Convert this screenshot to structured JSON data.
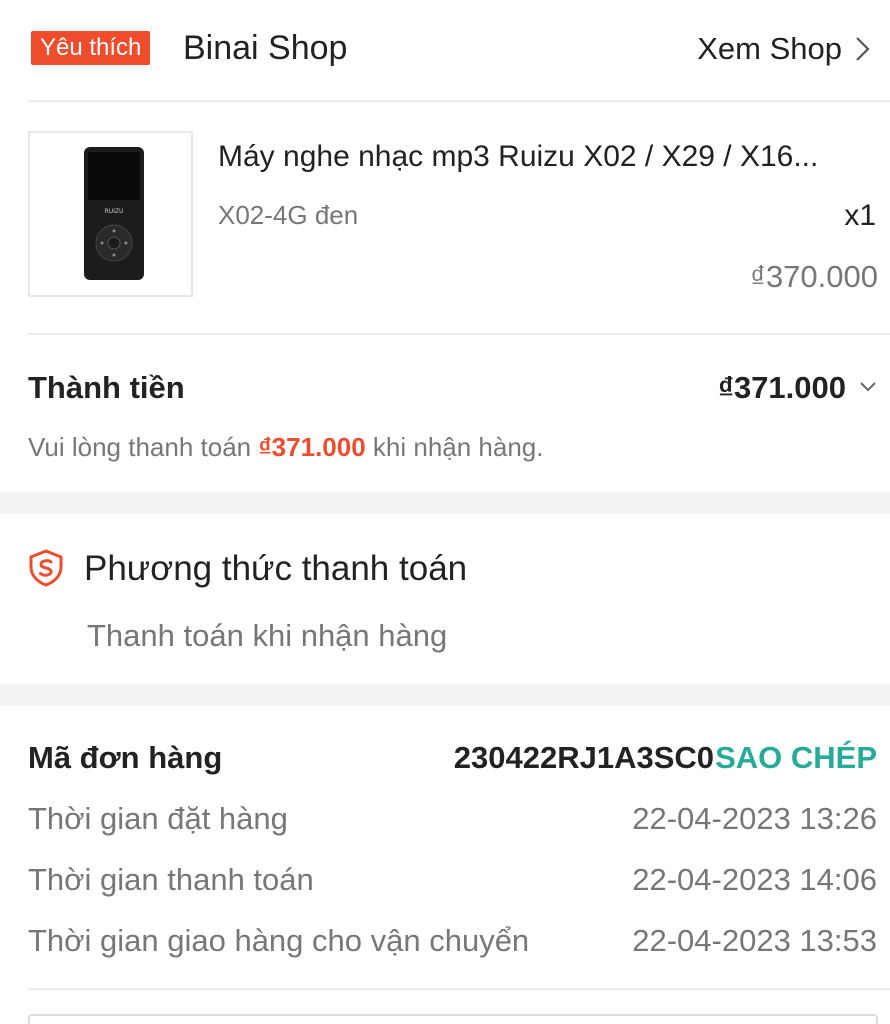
{
  "shop": {
    "badge": "Yêu thích",
    "name": "Binai Shop",
    "view_label": "Xem Shop"
  },
  "product": {
    "title": "Máy nghe nhạc mp3 Ruizu X02 / X29 / X16...",
    "variant": "X02-4G đen",
    "quantity": "x1",
    "price": "₫370.000",
    "image_brand": "RUIZU"
  },
  "total": {
    "label": "Thành tiền",
    "value": "₫371.000",
    "note_prefix": "Vui lòng thanh toán ",
    "note_amount": "₫371.000",
    "note_suffix": " khi nhận hàng."
  },
  "payment": {
    "title": "Phương thức thanh toán",
    "method": "Thanh toán khi nhận hàng"
  },
  "order": {
    "code_label": "Mã đơn hàng",
    "code": "230422RJ1A3SC0",
    "copy_label": "SAO CHÉP",
    "rows": [
      {
        "label": "Thời gian đặt hàng",
        "value": "22-04-2023 13:26"
      },
      {
        "label": "Thời gian thanh toán",
        "value": "22-04-2023 14:06"
      },
      {
        "label": "Thời gian giao hàng cho vận chuyển",
        "value": "22-04-2023 13:53"
      }
    ]
  },
  "colors": {
    "accent": "#ee4d2d",
    "copy": "#26aa99",
    "muted": "#777777",
    "text": "#222222",
    "gap": "#f3f3f3"
  },
  "icons": {
    "chevron_right": "chevron-right-icon",
    "chevron_down": "chevron-down-icon",
    "payment": "shield-payment-icon"
  }
}
